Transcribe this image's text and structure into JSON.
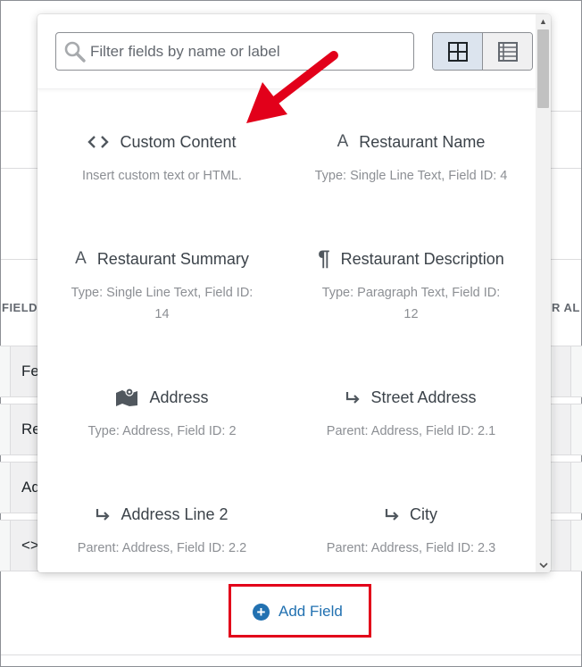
{
  "search": {
    "placeholder": "Filter fields by name or label",
    "value": ""
  },
  "view_toggle": {
    "grid_icon": "grid-view-icon",
    "list_icon": "list-view-icon",
    "active": "grid"
  },
  "fields": [
    {
      "icon": "code-icon",
      "label": "Custom Content",
      "description": "Insert custom text or HTML."
    },
    {
      "icon": "text-a-icon",
      "label": "Restaurant Name",
      "description": "Type: Single Line Text, Field ID: 4"
    },
    {
      "icon": "text-a-icon",
      "label": "Restaurant Summary",
      "description": "Type: Single Line Text, Field ID: 14"
    },
    {
      "icon": "paragraph-icon",
      "label": "Restaurant Description",
      "description": "Type: Paragraph Text, Field ID: 12"
    },
    {
      "icon": "map-icon",
      "label": "Address",
      "description": "Type: Address, Field ID: 2"
    },
    {
      "icon": "subfield-arrow-icon",
      "label": "Street Address",
      "description": "Parent: Address, Field ID: 2.1"
    },
    {
      "icon": "subfield-arrow-icon",
      "label": "Address Line 2",
      "description": "Parent: Address, Field ID: 2.2"
    },
    {
      "icon": "subfield-arrow-icon",
      "label": "City",
      "description": "Parent: Address, Field ID: 2.3"
    }
  ],
  "background": {
    "header_left": "FIELD",
    "header_right": "R AL",
    "rows": [
      "Fe",
      "Re",
      "Ad",
      "<>"
    ]
  },
  "add_field": {
    "label": "Add Field"
  },
  "colors": {
    "accent": "#2271b1",
    "highlight": "#e2001a",
    "active_toggle": "#dce4ee"
  }
}
